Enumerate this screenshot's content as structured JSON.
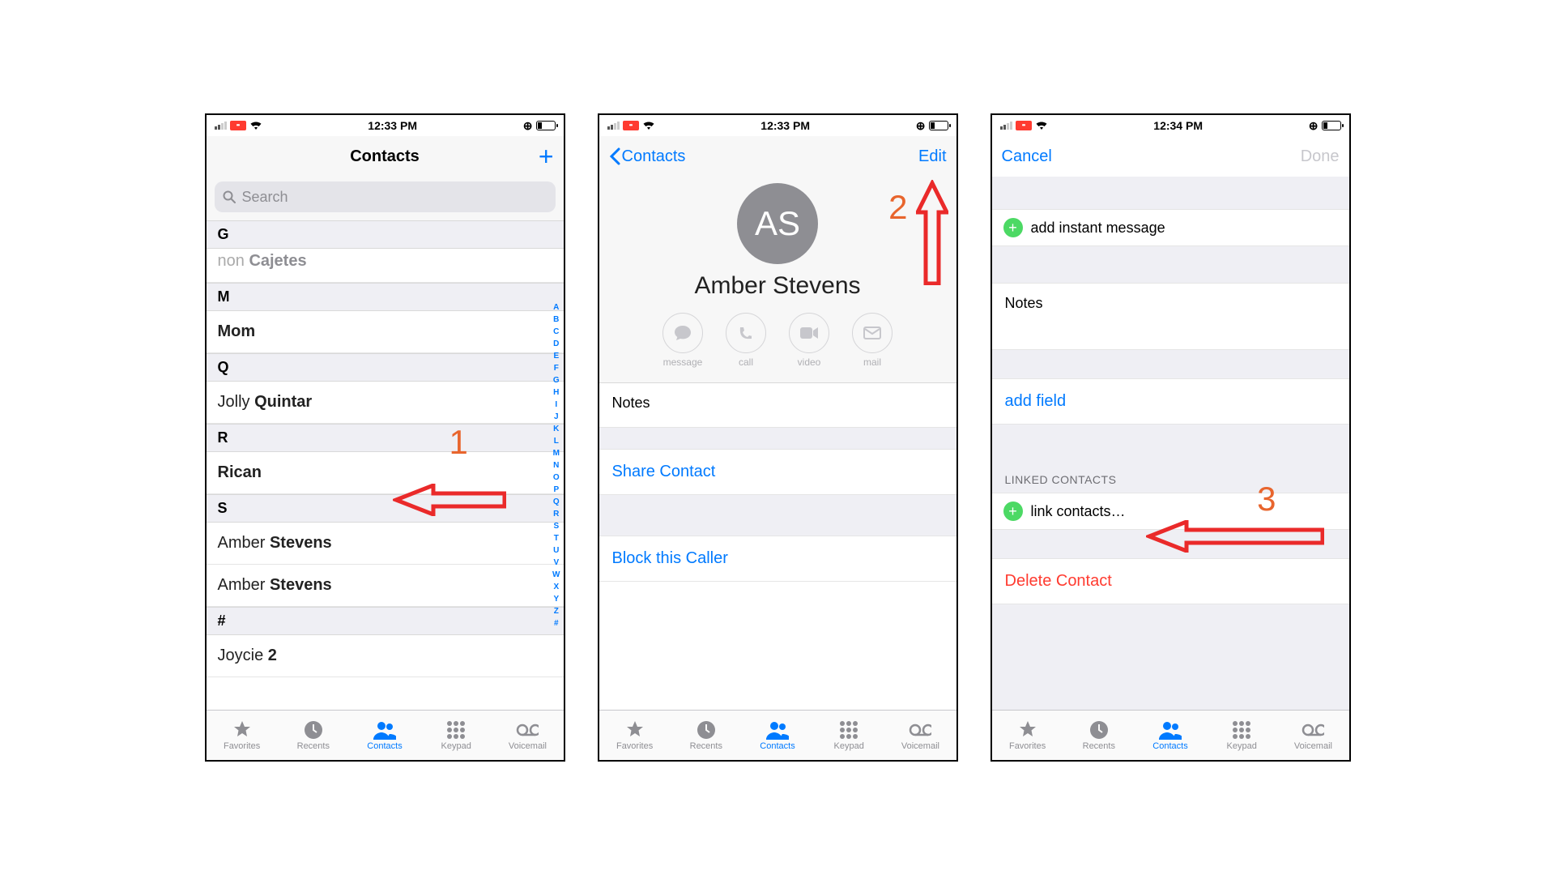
{
  "screen1": {
    "status_time": "12:33 PM",
    "title": "Contacts",
    "search_placeholder": "Search",
    "partial_row": "Cajetes",
    "sections": {
      "a": {
        "hdr": "G"
      },
      "b": {
        "hdr": "M",
        "row0": "Mom"
      },
      "c": {
        "hdr": "Q",
        "row0_pre": "Jolly ",
        "row0_b": "Quintar"
      },
      "d": {
        "hdr": "R",
        "row0": "Rican"
      },
      "e": {
        "hdr": "S",
        "row0_pre": "Amber ",
        "row0_b": "Stevens",
        "row1_pre": "Amber ",
        "row1_b": "Stevens"
      },
      "f": {
        "hdr": "#",
        "row0_pre": "Joycie ",
        "row0_b": "2"
      }
    },
    "index_letters": [
      "A",
      "B",
      "C",
      "D",
      "E",
      "F",
      "G",
      "H",
      "I",
      "J",
      "K",
      "L",
      "M",
      "N",
      "O",
      "P",
      "Q",
      "R",
      "S",
      "T",
      "U",
      "V",
      "W",
      "X",
      "Y",
      "Z",
      "#"
    ],
    "anno_number": "1"
  },
  "screen2": {
    "status_time": "12:33 PM",
    "back_label": "Contacts",
    "edit_label": "Edit",
    "avatar_initials": "AS",
    "contact_name": "Amber Stevens",
    "action_message": "message",
    "action_call": "call",
    "action_video": "video",
    "action_mail": "mail",
    "notes_label": "Notes",
    "share_label": "Share Contact",
    "block_label": "Block this Caller",
    "anno_number": "2"
  },
  "screen3": {
    "status_time": "12:34 PM",
    "cancel_label": "Cancel",
    "done_label": "Done",
    "add_im_label": "add instant message",
    "notes_label": "Notes",
    "add_field_label": "add field",
    "linked_section": "LINKED CONTACTS",
    "link_contacts_label": "link contacts…",
    "delete_label": "Delete Contact",
    "anno_number": "3"
  },
  "tabs": {
    "favorites": "Favorites",
    "recents": "Recents",
    "contacts": "Contacts",
    "keypad": "Keypad",
    "voicemail": "Voicemail"
  }
}
